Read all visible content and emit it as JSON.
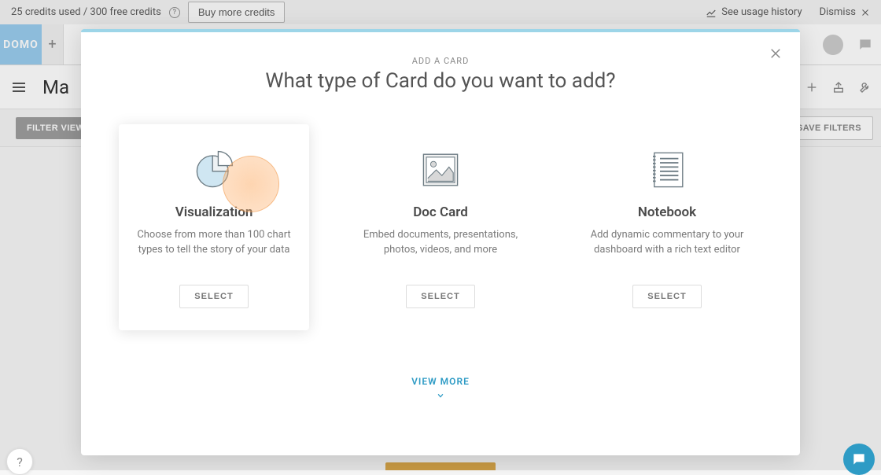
{
  "credits": {
    "text": "25 credits used / 300 free credits",
    "buy_label": "Buy more credits",
    "usage_label": "See usage history",
    "dismiss_label": "Dismiss"
  },
  "app": {
    "logo_text": "DOMO"
  },
  "page": {
    "title_visible": "Ma",
    "filter_views_label": "FILTER VIEWS",
    "save_filters_label": "SAVE FILTERS"
  },
  "modal": {
    "kicker": "ADD A CARD",
    "title": "What type of Card do you want to add?",
    "view_more_label": "VIEW MORE",
    "select_label": "SELECT",
    "options": [
      {
        "title": "Visualization",
        "desc": "Choose from more than 100 chart types to tell the story of your data"
      },
      {
        "title": "Doc Card",
        "desc": "Embed documents, presentations, photos, videos, and more"
      },
      {
        "title": "Notebook",
        "desc": "Add dynamic commentary to your dashboard with a rich text editor"
      }
    ]
  }
}
